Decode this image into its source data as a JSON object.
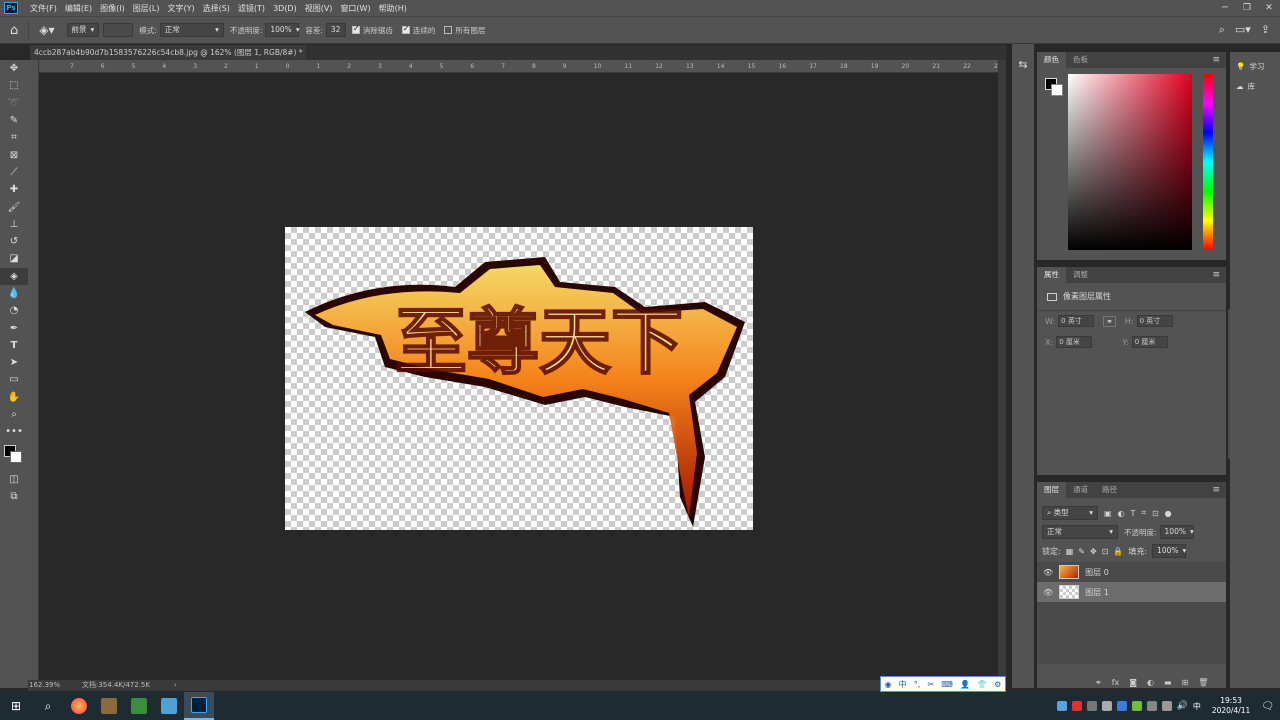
{
  "app": {
    "logo": "Ps"
  },
  "menu": [
    "文件(F)",
    "编辑(E)",
    "图像(I)",
    "图层(L)",
    "文字(Y)",
    "选择(S)",
    "滤镜(T)",
    "3D(D)",
    "视图(V)",
    "窗口(W)",
    "帮助(H)"
  ],
  "options": {
    "fill_source": "前景",
    "mode_label": "模式:",
    "mode_value": "正常",
    "opacity_label": "不透明度:",
    "opacity_value": "100%",
    "tolerance_label": "容差:",
    "tolerance_value": "32",
    "antialias_label": "消除锯齿",
    "contiguous_label": "连续的",
    "all_layers_label": "所有图层"
  },
  "document": {
    "tab_title": "4ccb287ab4b90d7b1583576226c54cb8.jpg @ 162% (图层 1, RGB/8#) *",
    "artwork_text": "至尊天下"
  },
  "ruler": {
    "h_labels": [
      "7",
      "6",
      "5",
      "4",
      "3",
      "2",
      "1",
      "0",
      "1",
      "2",
      "3",
      "4",
      "5",
      "6",
      "7",
      "8",
      "9",
      "10",
      "11",
      "12",
      "13",
      "14",
      "15",
      "16",
      "17",
      "18",
      "19",
      "20",
      "21",
      "22",
      "23"
    ]
  },
  "status": {
    "zoom": "162.39%",
    "doc_info": "文档:354.4K/472.5K"
  },
  "panels": {
    "color": {
      "tabs": [
        "颜色",
        "色板"
      ]
    },
    "properties": {
      "tabs": [
        "属性",
        "调整"
      ],
      "heading": "像素图层属性",
      "w_label": "W:",
      "w_value": "0 英寸",
      "h_label": "H:",
      "h_value": "0 英寸",
      "x_label": "X:",
      "x_value": "0 厘米",
      "y_label": "Y:",
      "y_value": "0 厘米"
    },
    "layers": {
      "tabs": [
        "图层",
        "通道",
        "路径"
      ],
      "filter_label": "类型",
      "blend_mode": "正常",
      "opacity_label": "不透明度:",
      "opacity_value": "100%",
      "lock_label": "锁定:",
      "fill_label": "填充:",
      "fill_value": "100%",
      "items": [
        {
          "name": "图层 0",
          "selected": false
        },
        {
          "name": "图层 1",
          "selected": true
        }
      ]
    },
    "right": {
      "learn": "学习",
      "library": "库"
    }
  },
  "taskbar": {
    "time": "19:53",
    "date": "2020/4/11",
    "ime_lang": "中"
  },
  "ime_bar": {
    "lang": "中"
  },
  "colors": {
    "accent": "#31a8ff",
    "panel_bg": "#535353",
    "canvas_bg": "#282828"
  }
}
